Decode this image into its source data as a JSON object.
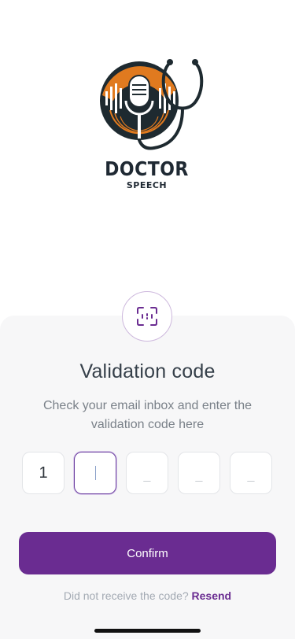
{
  "logo": {
    "title": "DOCTOR",
    "subtitle": "SPEECH",
    "icon": "microphone-stethoscope-icon",
    "colors": {
      "orange": "#e07a1f",
      "dark": "#1e2a30"
    }
  },
  "badge": {
    "icon": "scan-code-icon"
  },
  "validation": {
    "title": "Validation code",
    "instructions": "Check your email inbox and enter the validation code here"
  },
  "code_inputs": [
    {
      "value": "1",
      "placeholder": ""
    },
    {
      "value": "",
      "placeholder": ""
    },
    {
      "value": "",
      "placeholder": "_"
    },
    {
      "value": "",
      "placeholder": "_"
    },
    {
      "value": "",
      "placeholder": "_"
    }
  ],
  "confirm_label": "Confirm",
  "resend": {
    "prompt": "Did not receive the code?",
    "link": "Resend"
  },
  "colors": {
    "primary": "#6a2c91",
    "sheet": "#f7f7f8"
  }
}
